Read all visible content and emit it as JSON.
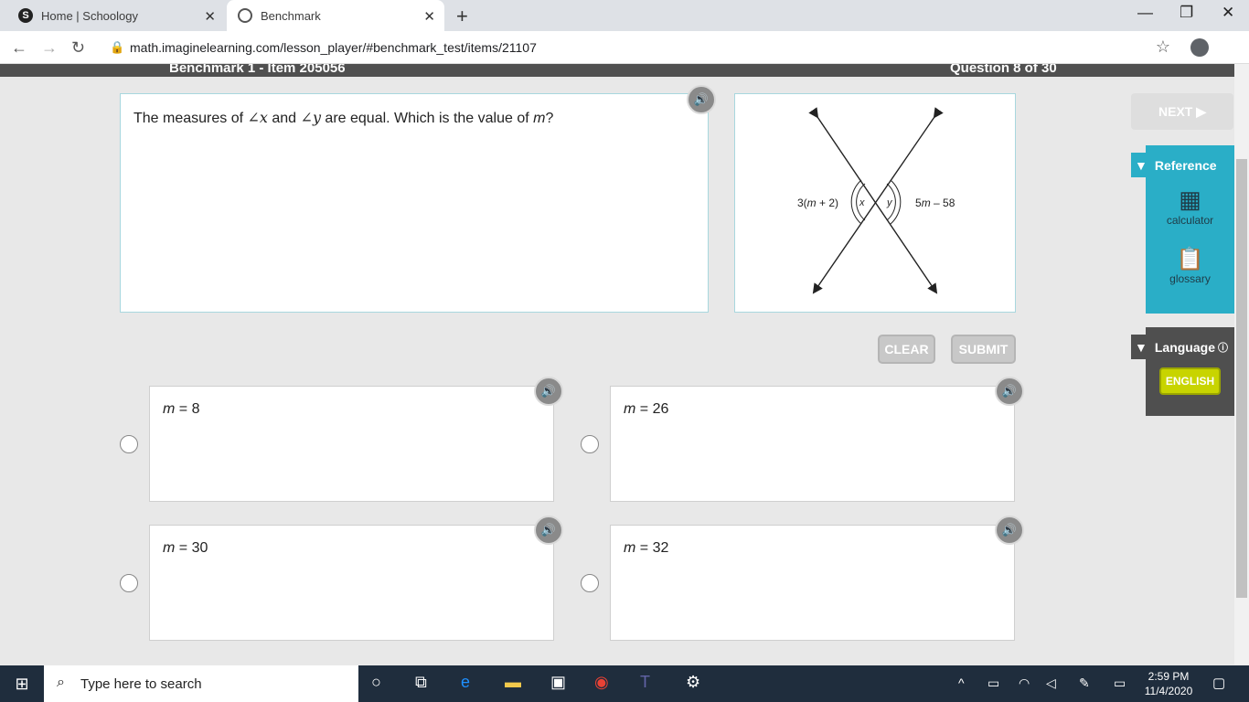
{
  "browser": {
    "tabs": [
      {
        "title": "Home | Schoology"
      },
      {
        "title": "Benchmark"
      }
    ],
    "url": "math.imaginelearning.com/lesson_player/#benchmark_test/items/21107"
  },
  "header": {
    "left": "Benchmark 1 - Item 205056",
    "right": "Question 8 of 30"
  },
  "question": {
    "p1": "The measures of ",
    "angle_x": "∠x",
    "p2": " and ",
    "angle_y": "∠y",
    "p3": " are equal. Which is the value of ",
    "var_m": "m",
    "p4": "?"
  },
  "figure": {
    "left_label_a": "3(",
    "left_label_m": "m",
    "left_label_b": " + 2)",
    "right_label_a": "5",
    "right_label_m": "m",
    "right_label_b": " – 58",
    "x": "x",
    "y": "y"
  },
  "buttons": {
    "clear": "CLEAR",
    "submit": "SUBMIT",
    "next": "NEXT ▶"
  },
  "answers": [
    {
      "var": "m",
      "rest": " = 8"
    },
    {
      "var": "m",
      "rest": " = 26"
    },
    {
      "var": "m",
      "rest": " = 30"
    },
    {
      "var": "m",
      "rest": " = 32"
    }
  ],
  "sidebar": {
    "reference": "Reference",
    "calculator": "calculator",
    "glossary": "glossary",
    "language": "Language",
    "english": "ENGLISH"
  },
  "taskbar": {
    "search_placeholder": "Type here to search",
    "time": "2:59 PM",
    "date": "11/4/2020"
  }
}
